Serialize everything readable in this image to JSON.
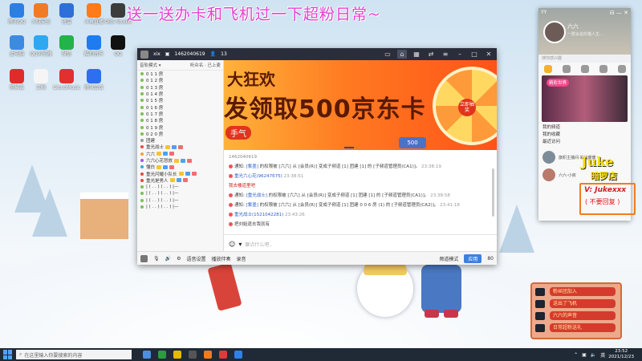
{
  "banner": "送一送办卡和飞机过一下超粉日常~",
  "desktop_icons": [
    {
      "label": "腾讯QQ",
      "color": "#2b7fe2"
    },
    {
      "label": "火绒安全",
      "color": "#f17a26"
    },
    {
      "label": "迅雷",
      "color": "#2f6fd8"
    },
    {
      "label": "斗鱼直播",
      "color": "#ff7a18"
    },
    {
      "label": "OBS Studio",
      "color": "#3c3c3c"
    },
    {
      "label": "此电脑",
      "color": "#3d8be0"
    },
    {
      "label": "QQ浏览器",
      "color": "#2fa8f0"
    },
    {
      "label": "微信",
      "color": "#24b24b"
    },
    {
      "label": "酷狗音乐",
      "color": "#1f7bf0"
    },
    {
      "label": "QQ",
      "color": "#111111"
    },
    {
      "label": "网易云",
      "color": "#e02b2b"
    },
    {
      "label": "文档",
      "color": "#f5f5f5"
    },
    {
      "label": "CloudMusic",
      "color": "#e03030"
    },
    {
      "label": "腾讯会议",
      "color": "#2d6ff0"
    }
  ],
  "window": {
    "room_name": "xix",
    "room_id": "1462040619",
    "online": "13"
  },
  "sidebar": {
    "header": "音轨模式 ▾",
    "header2": "听众名 · 已上麦",
    "rows": [
      "0 1 1 房",
      "0 1 2 房",
      "0 1 3 房",
      "0 1 4 房",
      "0 1 5 房",
      "0 1 6 房",
      "0 1 7 房",
      "0 1 8 房",
      "0 1 9 房",
      "0 2 0 房"
    ],
    "section_label": "团建",
    "users": [
      "重光战士",
      "六六",
      "六六心花怒放",
      "懂白",
      "重光闪耀小队长",
      "重光是男人"
    ],
    "symbols": [
      "| ( . . )  ( . . ) |—",
      "| ( . . )  ( . . ) |—",
      "| ( . . )  ( . . ) |—",
      "| ( . . )  ( . . ) |—"
    ],
    "misc": "嘿嘿"
  },
  "ad": {
    "line1": "大狂欢",
    "line2": "发领取500京东卡",
    "line3": "手气",
    "wheel_center": "立即抽奖",
    "card": "500"
  },
  "chat": {
    "top_id": "1462040619",
    "messages": [
      {
        "pre": "通知:",
        "name": "[紫墨]",
        "text": "的权限被 [六六] 从 [会员(R)] 变成子频道 [1] 团建",
        "tail": "[1] 的 [子频道管理员(CA1)]。",
        "time": "23:38:19",
        "red": false
      },
      {
        "pre": "",
        "name": "重光六心花(96247675)",
        "text": "",
        "tail": "",
        "time": "23:38:51",
        "red": false
      },
      {
        "pre": "",
        "name": "",
        "text": "我去楼道里吧",
        "tail": "",
        "time": "",
        "red": true
      },
      {
        "pre": "通知:",
        "name": "[重光战士]",
        "text": "的权限被 [六六] 从 [会员(R)] 变成子频道 [1] 团建",
        "tail": "[1] 的 [子频道管理员(CA1)]。",
        "time": "23:38:58",
        "red": false
      },
      {
        "pre": "通知:",
        "name": "[紫墨]",
        "text": "的权限被 [六六] 从 [会员(R)] 变成子频道 [1] 团建 0 0 6 房",
        "tail": "(1) 的 [子频道管理员(CA2)]。",
        "time": "23:41:18",
        "red": false
      },
      {
        "pre": "",
        "name": "重光战士(1521042281)",
        "text": "",
        "tail": "",
        "time": "23:43:26",
        "red": false
      },
      {
        "pre": "",
        "name": "",
        "text": "把刘姐遣去我就有",
        "tail": "",
        "time": "",
        "red": false
      }
    ]
  },
  "input": {
    "placeholder": "聊点什么吧.."
  },
  "bottombar": {
    "voice": "语音设置",
    "play": "播放伴奏",
    "record": "录音",
    "mode": "频道模式",
    "send": "应用",
    "num": "80"
  },
  "right": {
    "title": "YY",
    "name": "六六",
    "sig": "一群会说的猫人生...",
    "search": "搜你感兴趣",
    "tab1": "精彩世界",
    "list": [
      "我的频道",
      "我的收藏",
      "最近访问"
    ],
    "items": [
      {
        "name": "旗帜主播间·彩光暖暖",
        "sub": "2707200"
      },
      {
        "name": "六六-小房",
        "sub": ""
      }
    ]
  },
  "watermark": {
    "l1": "Juke",
    "l2": "暗罗店",
    "l3": "V: Jukexxx",
    "l4": "( 不要回复 )"
  },
  "fans": [
    "粉丝团加入",
    "送出了飞机",
    "六六的声音",
    "日常超粉送礼"
  ],
  "taskbar": {
    "search": "在这里输入你要搜索的内容",
    "time": "23:52",
    "date": "2021/12/23"
  }
}
